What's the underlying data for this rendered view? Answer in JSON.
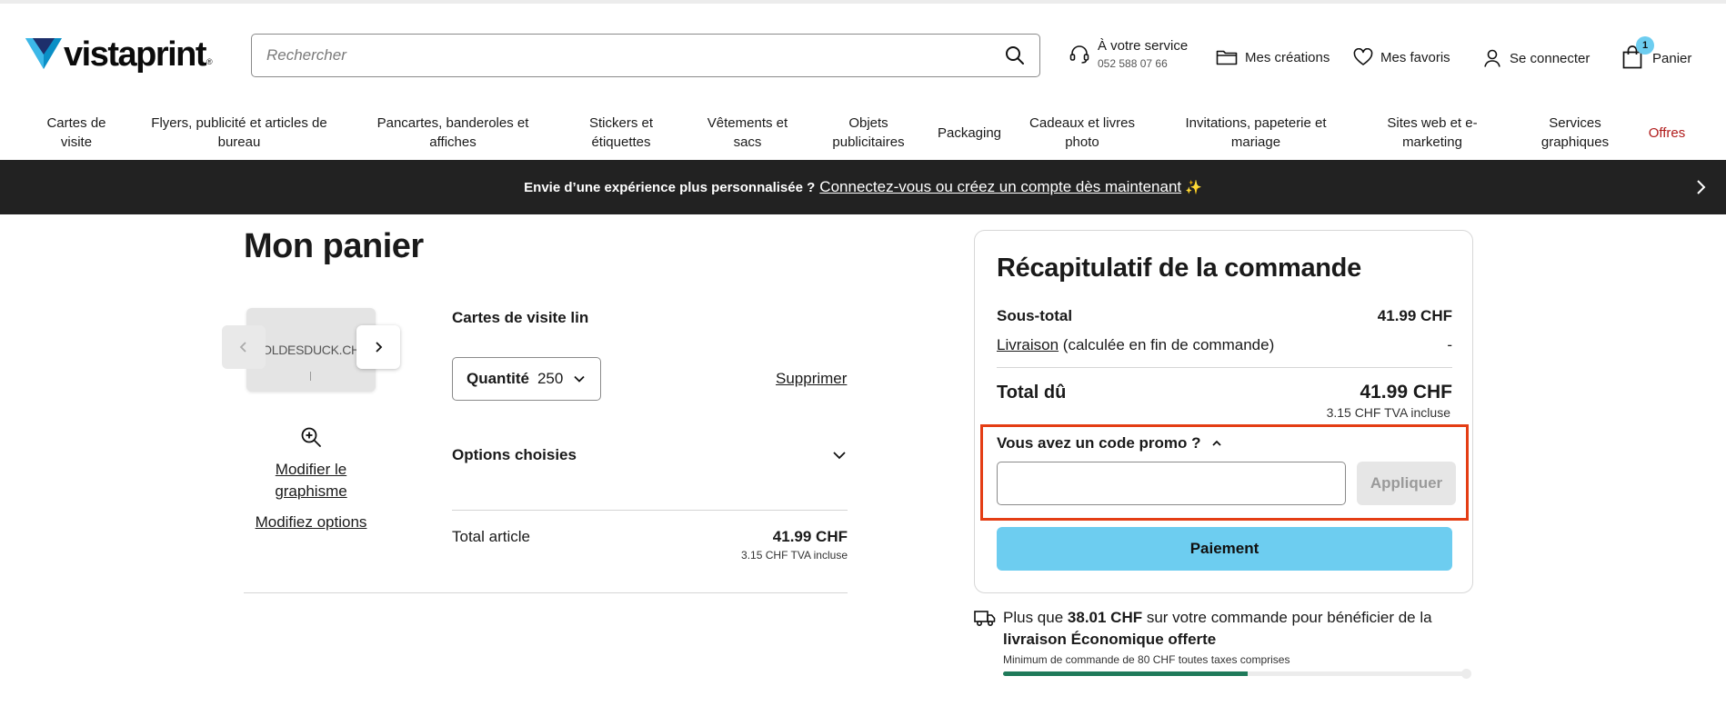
{
  "header": {
    "logo_text": "vistaprint",
    "logo_reg": "®",
    "search_placeholder": "Rechercher",
    "service_label": "À votre service",
    "service_phone": "052 588 07 66",
    "creations_label": "Mes créations",
    "favoris_label": "Mes favoris",
    "login_label": "Se connecter",
    "cart_label": "Panier",
    "cart_count": "1"
  },
  "nav": {
    "items": [
      {
        "label": "Cartes de\nvisite"
      },
      {
        "label": "Flyers, publicité et articles de\nbureau"
      },
      {
        "label": "Pancartes, banderoles et\naffiches"
      },
      {
        "label": "Stickers et\nétiquettes"
      },
      {
        "label": "Vêtements et\nsacs"
      },
      {
        "label": "Objets\npublicitaires"
      },
      {
        "label": "Packaging"
      },
      {
        "label": "Cadeaux et livres\nphoto"
      },
      {
        "label": "Invitations, papeterie et\nmariage"
      },
      {
        "label": "Sites web et e-\nmarketing"
      },
      {
        "label": "Services\ngraphiques"
      },
      {
        "label": "Offres"
      }
    ]
  },
  "banner": {
    "text": "Envie d’une expérience plus personnalisée ?",
    "link": "Connectez-vous ou créez un compte dès maintenant",
    "spark": "✨"
  },
  "cart": {
    "title": "Mon panier",
    "thumb_text": "OLDESDUCK.CH",
    "edit_design": "Modifier le graphisme",
    "edit_options": "Modifiez options",
    "product_name": "Cartes de visite lin",
    "qty_label": "Quantité",
    "qty_value": "250",
    "delete_label": "Supprimer",
    "options_label": "Options choisies",
    "total_label": "Total article",
    "total_price": "41.99 CHF",
    "total_vat": "3.15 CHF TVA incluse"
  },
  "summary": {
    "title": "Récapitulatif de la commande",
    "subtotal_label": "Sous-total",
    "subtotal_value": "41.99 CHF",
    "shipping_link": "Livraison",
    "shipping_note": "(calculée en fin de commande)",
    "shipping_value": "-",
    "total_label": "Total dû",
    "total_value": "41.99 CHF",
    "total_vat": "3.15 CHF TVA incluse",
    "promo_label": "Vous avez un code promo ?",
    "promo_value": "",
    "apply_label": "Appliquer",
    "pay_label": "Paiement"
  },
  "shipping_promo": {
    "text_before": "Plus que",
    "amount": "38.01 CHF",
    "text_middle": "sur votre commande pour bénéficier de la",
    "offer": "livraison Économique offerte",
    "minimum": "Minimum de commande de 80 CHF toutes taxes comprises",
    "progress_fraction": 0.525
  },
  "colors": {
    "accent_blue": "#6dcdf0",
    "offres_red": "#b01b1b",
    "highlight_orange": "#e43d14",
    "progress_green": "#1f7a5a",
    "banner_dark": "#222222"
  },
  "icons": {
    "logo": "vistaprint-triangle-logo",
    "search": "search-icon",
    "service": "headset-icon",
    "creations": "folder-icon",
    "favoris": "heart-icon",
    "login": "user-icon",
    "cart": "shopping-bag-icon",
    "banner_next": "chevron-right-icon",
    "thumb_prev": "chevron-left-icon",
    "thumb_next": "chevron-right-icon",
    "zoom": "zoom-in-icon",
    "qty": "chevron-down-icon",
    "options": "chevron-down-icon",
    "promo": "chevron-up-icon",
    "shipping": "truck-icon"
  }
}
